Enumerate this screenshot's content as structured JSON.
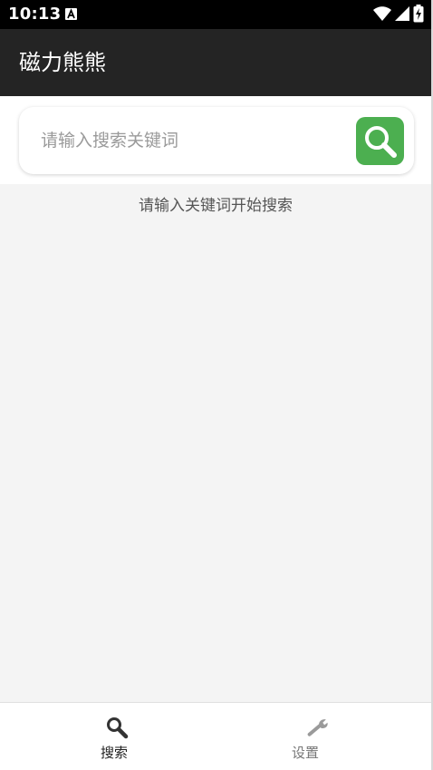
{
  "status_bar": {
    "time": "10:13",
    "icons": [
      "a-notification-icon",
      "wifi-icon",
      "cell-signal-icon",
      "battery-charging-icon"
    ]
  },
  "app_bar": {
    "title": "磁力熊熊"
  },
  "search": {
    "placeholder": "请输入搜索关键词",
    "value": "",
    "button_icon": "search-icon"
  },
  "main": {
    "hint": "请输入关键词开始搜索"
  },
  "bottom_nav": {
    "items": [
      {
        "label": "搜索",
        "icon": "search-icon",
        "active": true
      },
      {
        "label": "设置",
        "icon": "wrench-icon",
        "active": false
      }
    ]
  },
  "colors": {
    "status_bar": "#000000",
    "app_bar": "#242424",
    "accent": "#4caf50",
    "background": "#f4f4f4"
  }
}
